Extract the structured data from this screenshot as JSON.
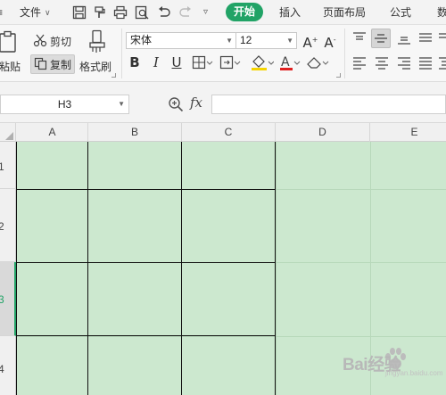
{
  "menubar": {
    "file_label": "文件",
    "tabs": [
      "开始",
      "插入",
      "页面布局",
      "公式",
      "数"
    ]
  },
  "ribbon": {
    "paste_label": "粘贴",
    "cut_label": "剪切",
    "copy_label": "复制",
    "format_painter_label": "格式刷",
    "font_name": "宋体",
    "font_size": "12"
  },
  "formula_bar": {
    "cell_reference": "H3",
    "fx_label": "fx",
    "formula_value": ""
  },
  "sheet": {
    "columns": [
      "A",
      "B",
      "C",
      "D",
      "E"
    ],
    "rows": [
      "1",
      "2",
      "3",
      "4"
    ],
    "active_row": "3",
    "background_color": "#cce8cf",
    "accent_color": "#21a366"
  },
  "watermark": {
    "text": "Bai经验",
    "sub": "jingyan.baidu.com"
  }
}
